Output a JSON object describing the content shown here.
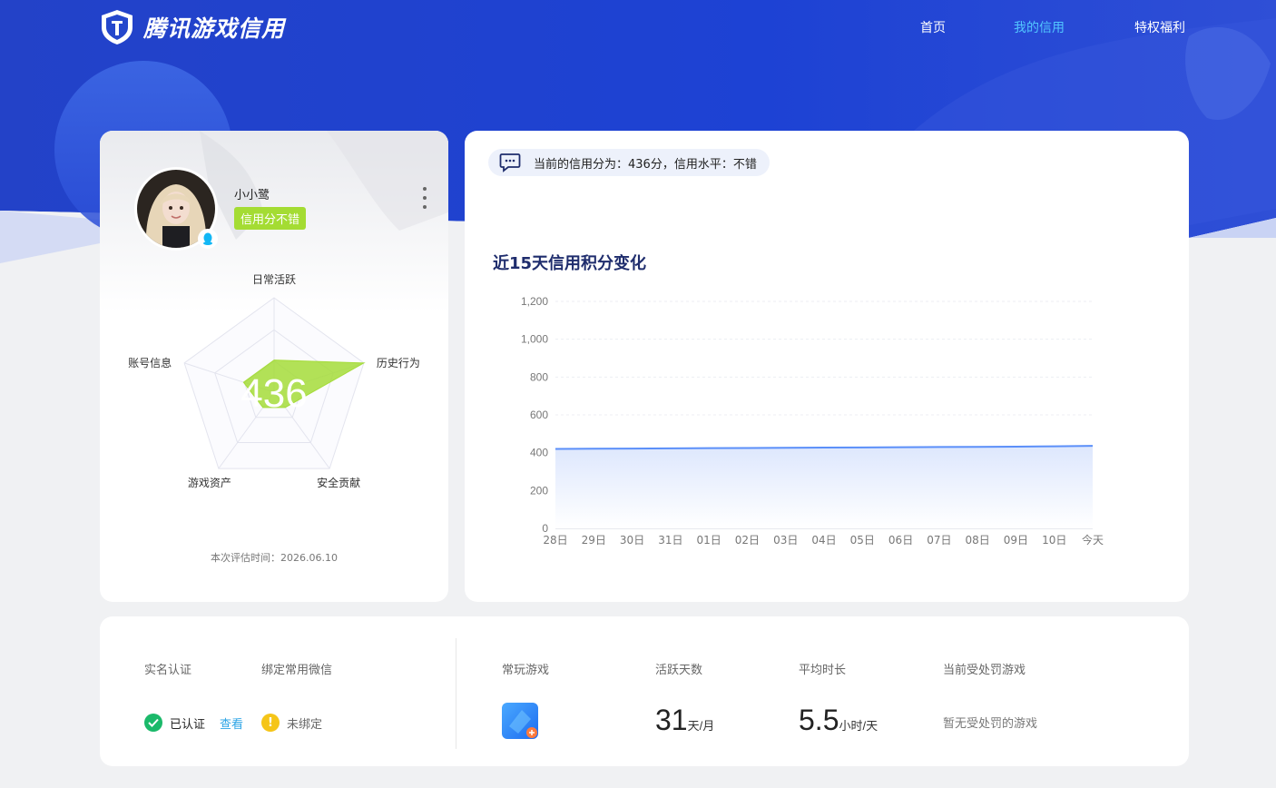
{
  "header": {
    "logo_text": "腾讯游戏信用",
    "nav": [
      {
        "label": "首页",
        "active": false
      },
      {
        "label": "我的信用",
        "active": true
      },
      {
        "label": "特权福利",
        "active": false
      }
    ]
  },
  "profile": {
    "username": "小小鹭",
    "credit_tag": "信用分不错",
    "radar": {
      "score": "436",
      "axes": [
        "日常活跃",
        "历史行为",
        "安全贡献",
        "游戏资产",
        "账号信息"
      ],
      "values": [
        0.34,
        1.0,
        0.2,
        0.2,
        0.34
      ]
    },
    "eval_time": "本次评估时间：2026.06.10"
  },
  "credit_panel": {
    "summary": "当前的信用分为：436分，信用水平：不错",
    "chart_title": "近15天信用积分变化"
  },
  "chart_data": {
    "type": "area",
    "title": "近15天信用积分变化",
    "x": [
      "28日",
      "29日",
      "30日",
      "31日",
      "01日",
      "02日",
      "03日",
      "04日",
      "05日",
      "06日",
      "07日",
      "08日",
      "09日",
      "10日",
      "今天"
    ],
    "values": [
      420,
      421,
      422,
      423,
      424,
      425,
      426,
      427,
      428,
      429,
      430,
      431,
      432,
      434,
      436
    ],
    "y_ticks": [
      "0",
      "200",
      "400",
      "600",
      "800",
      "1,000",
      "1,200"
    ],
    "ylim": [
      0,
      1200
    ],
    "grid": true,
    "line_color": "#5b8ff9"
  },
  "stats": {
    "realname_label": "实名认证",
    "wechat_label": "绑定常用微信",
    "realname_status": "已认证",
    "view_link": "查看",
    "wechat_status": "未绑定",
    "games_label": "常玩游戏",
    "active_days_label": "活跃天数",
    "active_days_value": "31",
    "active_days_unit": "天/月",
    "avg_time_label": "平均时长",
    "avg_time_value": "5.5",
    "avg_time_unit": "小时/天",
    "penalty_label": "当前受处罚游戏",
    "penalty_value": "暂无受处罚的游戏"
  }
}
